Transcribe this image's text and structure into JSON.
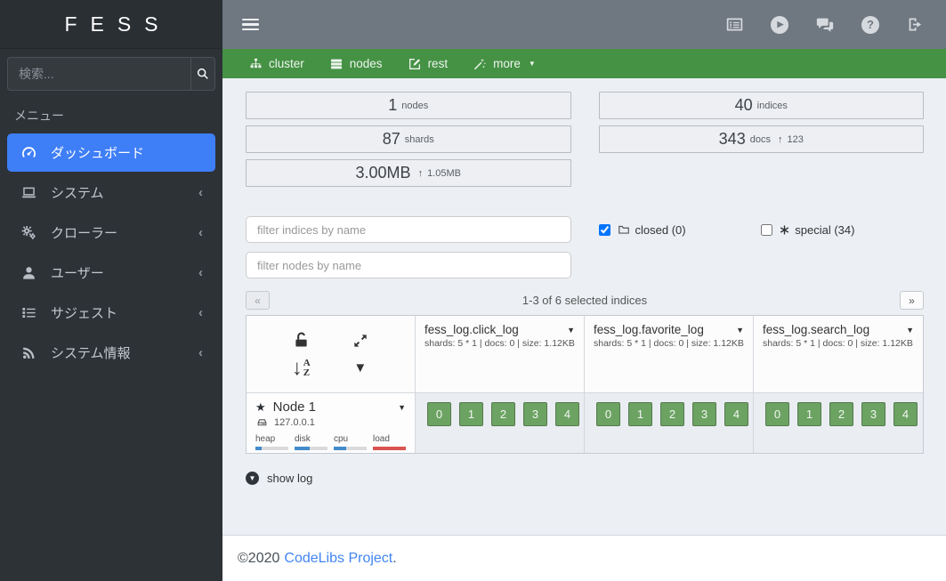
{
  "app": {
    "logo": "FESS"
  },
  "colors": {
    "sidebar_bg": "#2d3237",
    "active_item_blue": "#3e7ef7",
    "topbar_gray": "#6f7781",
    "navbar_green": "#459245",
    "content_bg": "#ecf0f5",
    "shard_green": "#6ca363",
    "metric_blue": "#428bca",
    "metric_red": "#d9534f",
    "link_blue": "#4285f4"
  },
  "sidebar": {
    "search": {
      "placeholder": "検索...",
      "icon": "search-icon"
    },
    "menu_header": "メニュー",
    "items": [
      {
        "label": "ダッシュボード",
        "icon": "tachometer-icon",
        "active": true
      },
      {
        "label": "システム",
        "icon": "laptop-icon",
        "active": false
      },
      {
        "label": "クローラー",
        "icon": "gears-icon",
        "active": false
      },
      {
        "label": "ユーザー",
        "icon": "user-icon",
        "active": false
      },
      {
        "label": "サジェスト",
        "icon": "list-icon",
        "active": false
      },
      {
        "label": "システム情報",
        "icon": "rss-icon",
        "active": false
      }
    ]
  },
  "topbar": {
    "menu_icon": "hamburger-icon",
    "action_icons": [
      "list-alt-icon",
      "play-circle-icon",
      "comments-icon",
      "question-circle-icon",
      "sign-out-icon"
    ]
  },
  "clusternav": {
    "cluster": {
      "label": "cluster",
      "icon": "sitemap-icon"
    },
    "nodes": {
      "label": "nodes",
      "icon": "server-icon"
    },
    "rest": {
      "label": "rest",
      "icon": "edit-icon"
    },
    "more": {
      "label": "more",
      "icon": "wand-icon"
    }
  },
  "overview": {
    "stats": {
      "nodes": {
        "value": "1",
        "label": "nodes"
      },
      "indices": {
        "value": "40",
        "label": "indices"
      },
      "shards": {
        "value": "87",
        "label": "shards"
      },
      "docs": {
        "value": "343",
        "label": "docs",
        "delta": "123"
      },
      "size": {
        "value": "3.00MB",
        "delta": "1.05MB"
      }
    },
    "filters": {
      "index_filter_placeholder": "filter indices by name",
      "node_filter_placeholder": "filter nodes by name",
      "closed": {
        "label": "closed (0)",
        "checked": true,
        "icon": "folder-icon"
      },
      "special": {
        "label": "special (34)",
        "checked": false,
        "icon": "asterisk-icon"
      }
    },
    "pagination": {
      "prev": "«",
      "next": "»",
      "summary": "1-3 of 6 selected indices"
    },
    "table": {
      "indices": [
        {
          "name": "fess_log.click_log",
          "meta": "shards: 5 * 1 | docs: 0 | size: 1.12KB",
          "shards": [
            "0",
            "1",
            "2",
            "3",
            "4"
          ]
        },
        {
          "name": "fess_log.favorite_log",
          "meta": "shards: 5 * 1 | docs: 0 | size: 1.12KB",
          "shards": [
            "0",
            "1",
            "2",
            "3",
            "4"
          ]
        },
        {
          "name": "fess_log.search_log",
          "meta": "shards: 5 * 1 | docs: 0 | size: 1.12KB",
          "shards": [
            "0",
            "1",
            "2",
            "3",
            "4"
          ]
        }
      ],
      "node": {
        "name": "Node 1",
        "ip": "127.0.0.1",
        "icon": "star-icon",
        "ip_icon": "hdd-icon",
        "metrics": [
          {
            "label": "heap",
            "pct": 18,
            "color": "#428bca"
          },
          {
            "label": "disk",
            "pct": 45,
            "color": "#428bca"
          },
          {
            "label": "cpu",
            "pct": 38,
            "color": "#428bca"
          },
          {
            "label": "load",
            "pct": 100,
            "color": "#d9534f"
          }
        ]
      }
    },
    "show_log": {
      "label": "show log",
      "icon": "chevron-circle-down-icon"
    }
  },
  "footer": {
    "copyright": "©2020",
    "link": "CodeLibs Project",
    "suffix": "."
  }
}
